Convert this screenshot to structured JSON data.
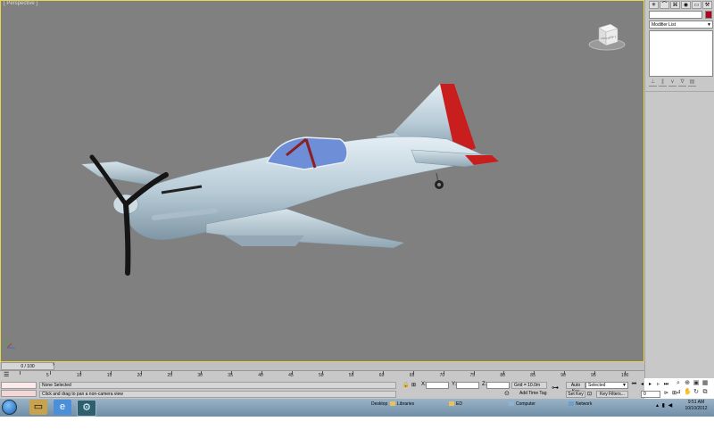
{
  "viewport": {
    "label": "[ Perspective ]",
    "viewcube_label": "LEFT",
    "viewcube_front": "FRONT"
  },
  "command_panel": {
    "tabs": [
      "create-icon",
      "modify-icon",
      "hierarchy-icon",
      "motion-icon",
      "display-icon",
      "utilities-icon"
    ],
    "modifier_list": "Modifier List",
    "object_color": "#b4001e"
  },
  "time_slider": {
    "position": "0 / 100",
    "ticks": [
      "0",
      "5",
      "10",
      "15",
      "20",
      "25",
      "30",
      "35",
      "40",
      "45",
      "50",
      "55",
      "60",
      "65",
      "70",
      "75",
      "80",
      "85",
      "90",
      "95",
      "100"
    ]
  },
  "status": {
    "selection": "None Selected",
    "prompt": "Click and drag to pan a non-camera view",
    "x_label": "X:",
    "y_label": "Y:",
    "z_label": "Z:",
    "grid": "Grid = 10.0m",
    "add_time_tag": "Add Time Tag",
    "auto_key": "Auto Key",
    "set_key": "Set Key",
    "key_mode": "Selected",
    "key_filters": "Key Filters...",
    "frame": "0"
  },
  "taskbar": {
    "links": [
      "Desktop",
      "Libraries",
      "ED",
      "Computer",
      "Network"
    ],
    "time": "9:51 AM",
    "date": "10/10/2012"
  }
}
